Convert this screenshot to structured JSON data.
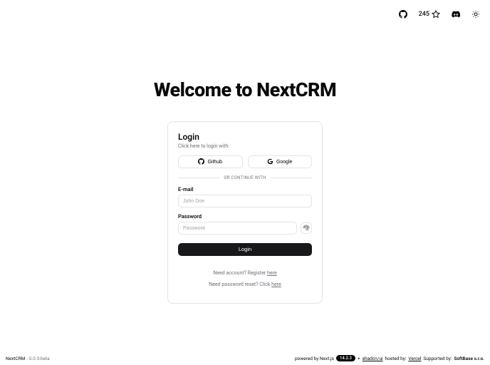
{
  "nav": {
    "stars": "245"
  },
  "heading": "Welcome to NextCRM",
  "card": {
    "title": "Login",
    "subtitle": "Click here to login with:",
    "github": "Github",
    "google": "Google",
    "divider": "OR CONTINUE WITH",
    "email_label": "E-mail",
    "email_placeholder": "John Doe",
    "password_label": "Password",
    "password_placeholder": "Password",
    "login_btn": "Login",
    "register_prefix": "Need account? Register ",
    "register_link": "here",
    "reset_prefix": "Need password reset? Click ",
    "reset_link": "here"
  },
  "footer": {
    "app": "NextCRM",
    "version": "- 0.0.3-beta",
    "powered": "powered by Next.js",
    "next_version": "14.2.3",
    "plus": "+",
    "shadcn": "shadcn/ui",
    "hosted": "hosted by:",
    "vercel": "Vercel",
    "supported": "Supported by:",
    "softbase": "SoftBase s.r.o."
  }
}
